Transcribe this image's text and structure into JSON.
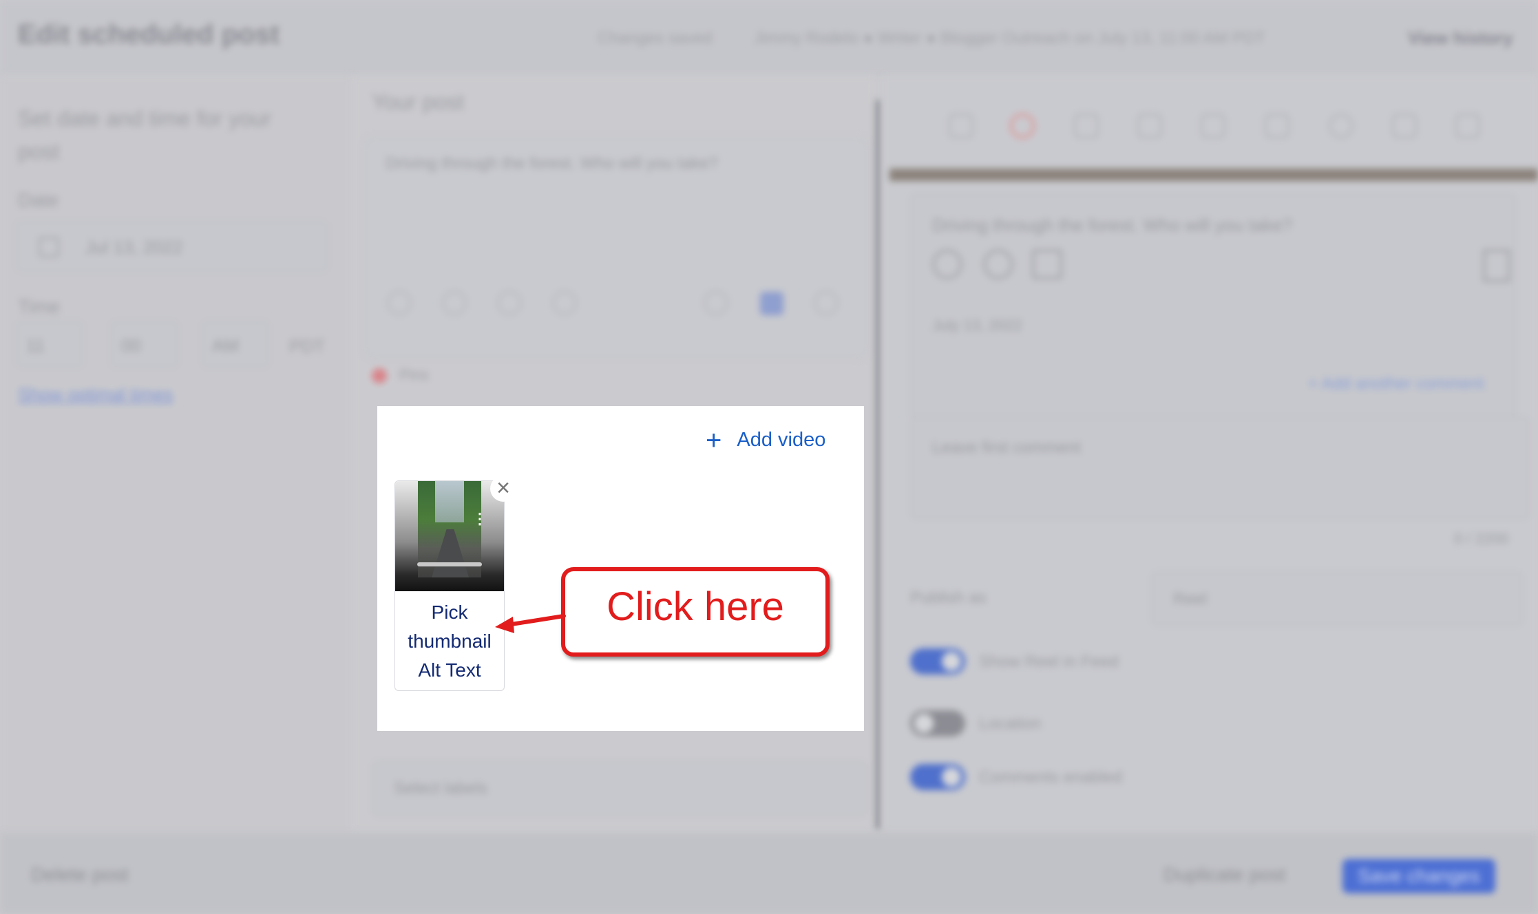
{
  "header": {
    "title": "Edit scheduled post",
    "status": "Changes saved",
    "author_line": "Jimmy Rodelo ● Writer ● Blogger Outreach on July 13, 11:00 AM PDT",
    "history_label": "View history"
  },
  "left": {
    "heading": "Set date and time for your post",
    "date_label": "Date",
    "date_value": "Jul 13, 2022",
    "time_label": "Time",
    "hour": "11",
    "minute": "00",
    "ampm": "AM",
    "timezone": "PDT",
    "optimal_link": "Show optimal times"
  },
  "middle": {
    "heading": "Your post",
    "post_text": "Driving through the forest. Who will you take?",
    "network_label": "Pins",
    "tags_placeholder": "Select labels"
  },
  "media_panel": {
    "add_video_label": "Add video",
    "pick_thumbnail_label": "Pick\nthumbnail\nAlt Text",
    "close_symbol": "×",
    "kebab_symbol": "⋮"
  },
  "callout": {
    "text": "Click here"
  },
  "preview": {
    "caption": "Driving through the forest. Who will you take?",
    "date": "July 13, 2022",
    "add_comment_link": "+ Add another comment",
    "comment_placeholder": "Leave first comment",
    "char_count": "0 / 2200",
    "publish_as_label": "Publish as",
    "publish_as_value": "Reel",
    "toggle_feed_label": "Show Reel in Feed",
    "toggle_location_label": "Location",
    "toggle_comments_label": "Comments enabled",
    "toggle_feed_on": true,
    "toggle_location_on": false,
    "toggle_comments_on": true
  },
  "footer": {
    "delete_label": "Delete post",
    "duplicate_label": "Duplicate post",
    "save_label": "Save changes"
  },
  "colors": {
    "accent": "#1a5fc9",
    "callout_red": "#e21c1c",
    "thumb_label": "#132a73"
  }
}
